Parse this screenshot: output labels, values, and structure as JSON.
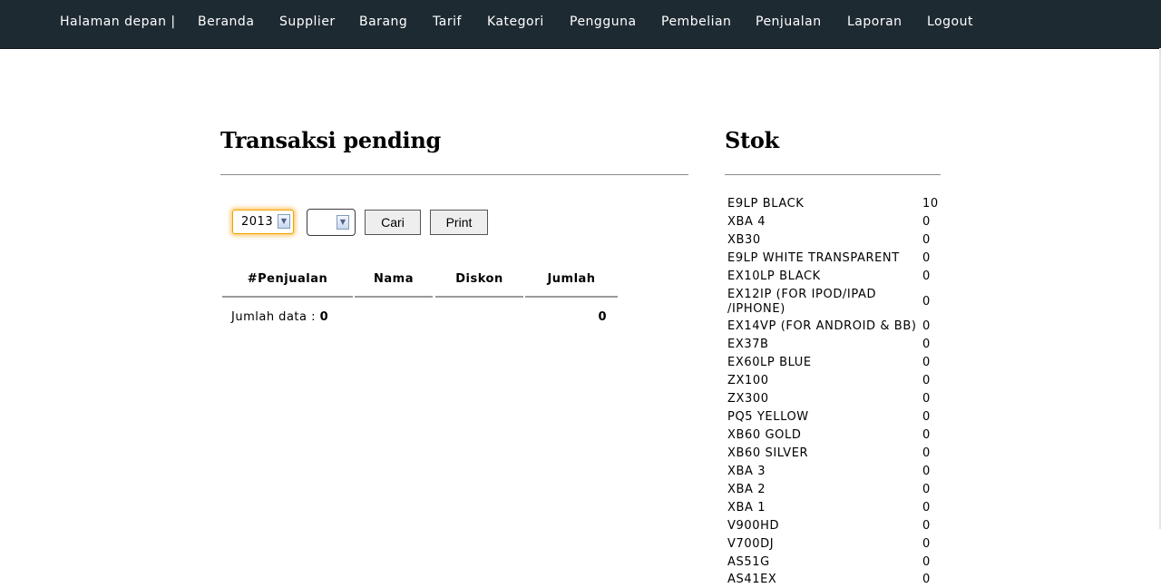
{
  "nav": {
    "items": [
      "Halaman depan |",
      "Beranda",
      "Supplier",
      "Barang",
      "Tarif",
      "Kategori",
      "Pengguna",
      "Pembelian",
      "Penjualan",
      "Laporan",
      "Logout"
    ]
  },
  "pending": {
    "title": "Transaksi pending",
    "filter": {
      "year": "2013",
      "month": "",
      "search_label": "Cari",
      "print_label": "Print"
    },
    "columns": [
      "#Penjualan",
      "Nama",
      "Diskon",
      "Jumlah"
    ],
    "summary_label": "Jumlah data :",
    "summary_count": "0",
    "summary_total": "0"
  },
  "stock": {
    "title": "Stok",
    "items": [
      {
        "name": "E9LP BLACK",
        "qty": "10"
      },
      {
        "name": "XBA 4",
        "qty": "0"
      },
      {
        "name": "XB30",
        "qty": "0"
      },
      {
        "name": "E9LP WHITE TRANSPARENT",
        "qty": "0"
      },
      {
        "name": "EX10LP BLACK",
        "qty": "0"
      },
      {
        "name": "EX12IP (FOR IPOD/IPAD /IPHONE)",
        "qty": "0"
      },
      {
        "name": "EX14VP (FOR ANDROID & BB)",
        "qty": "0"
      },
      {
        "name": "EX37B",
        "qty": "0"
      },
      {
        "name": "EX60LP BLUE",
        "qty": "0"
      },
      {
        "name": "ZX100",
        "qty": "0"
      },
      {
        "name": "ZX300",
        "qty": "0"
      },
      {
        "name": "PQ5 YELLOW",
        "qty": "0"
      },
      {
        "name": "XB60 GOLD",
        "qty": "0"
      },
      {
        "name": "XB60 SILVER",
        "qty": "0"
      },
      {
        "name": "XBA 3",
        "qty": "0"
      },
      {
        "name": "XBA 2",
        "qty": "0"
      },
      {
        "name": "XBA 1",
        "qty": "0"
      },
      {
        "name": "V900HD",
        "qty": "0"
      },
      {
        "name": "V700DJ",
        "qty": "0"
      },
      {
        "name": "AS51G",
        "qty": "0"
      },
      {
        "name": "AS41EX",
        "qty": "0"
      }
    ]
  }
}
